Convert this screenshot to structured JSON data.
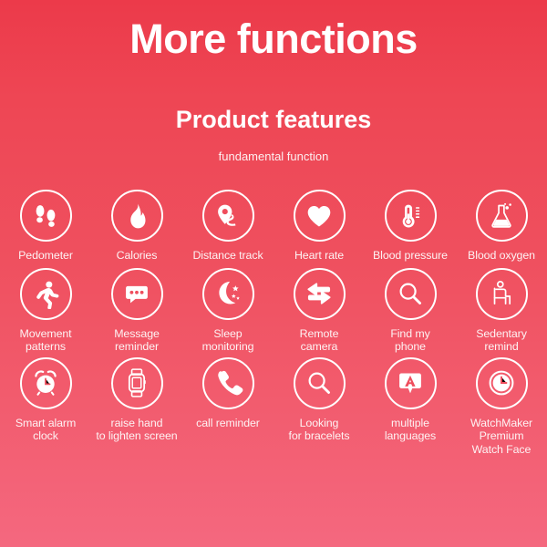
{
  "header": {
    "main_title": "More functions",
    "sub_title": "Product features",
    "tag_line": "fundamental function"
  },
  "theme": {
    "gradient_top": "#EC3A4A",
    "gradient_mid": "#EF505F",
    "gradient_bottom": "#F4687F",
    "icon_color": "#FFFFFF",
    "text_color": "#FFFFFF"
  },
  "feature_rows": [
    {
      "cells": [
        {
          "icon": "footprints-icon",
          "label": "Pedometer"
        },
        {
          "icon": "flame-icon",
          "label": "Calories"
        },
        {
          "icon": "location-pin-path-icon",
          "label": "Distance track"
        },
        {
          "icon": "heart-icon",
          "label": "Heart rate"
        },
        {
          "icon": "thermometer-icon",
          "label": "Blood pressure"
        },
        {
          "icon": "flask-icon",
          "label": "Blood oxygen"
        }
      ]
    },
    {
      "cells": [
        {
          "icon": "running-person-icon",
          "label": "Movement\npatterns"
        },
        {
          "icon": "speech-bubble-dots-icon",
          "label": "Message\nreminder"
        },
        {
          "icon": "moon-stars-icon",
          "label": "Sleep\nmonitoring"
        },
        {
          "icon": "double-arrow-icon",
          "label": "Remote\ncamera"
        },
        {
          "icon": "magnifier-icon",
          "label": "Find my\nphone"
        },
        {
          "icon": "seated-person-icon",
          "label": "Sedentary\nremind"
        }
      ]
    },
    {
      "cells": [
        {
          "icon": "alarm-clock-icon",
          "label": "Smart alarm\nclock"
        },
        {
          "icon": "smartwatch-icon",
          "label": "raise hand\nto lighten screen"
        },
        {
          "icon": "phone-handset-icon",
          "label": "call reminder"
        },
        {
          "icon": "magnifier-icon",
          "label": "Looking\nfor bracelets"
        },
        {
          "icon": "language-bubble-a-icon",
          "label": "multiple\nlanguages"
        },
        {
          "icon": "clock-face-icon",
          "label": "WatchMaker\nPremium\nWatch Face"
        }
      ]
    }
  ]
}
